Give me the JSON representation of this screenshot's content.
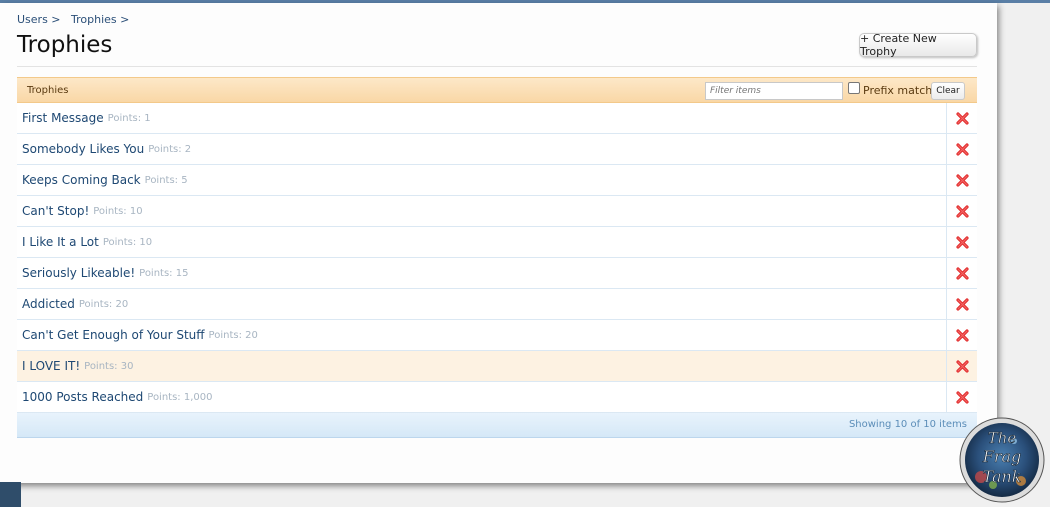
{
  "breadcrumb": [
    {
      "label": "Users >"
    },
    {
      "label": "Trophies >"
    }
  ],
  "page_title": "Trophies",
  "create_button_label": "+ Create New Trophy",
  "list_header": {
    "title": "Trophies",
    "filter_placeholder": "Filter items",
    "prefix_match_label": "Prefix match",
    "clear_label": "Clear"
  },
  "trophies": [
    {
      "name": "First Message",
      "points": "Points: 1"
    },
    {
      "name": "Somebody Likes You",
      "points": "Points: 2"
    },
    {
      "name": "Keeps Coming Back",
      "points": "Points: 5"
    },
    {
      "name": "Can't Stop!",
      "points": "Points: 10"
    },
    {
      "name": "I Like It a Lot",
      "points": "Points: 10"
    },
    {
      "name": "Seriously Likeable!",
      "points": "Points: 15"
    },
    {
      "name": "Addicted",
      "points": "Points: 20"
    },
    {
      "name": "Can't Get Enough of Your Stuff",
      "points": "Points: 20"
    },
    {
      "name": "I LOVE IT!",
      "points": "Points: 30"
    },
    {
      "name": "1000 Posts Reached",
      "points": "Points: 1,000"
    }
  ],
  "hovered_row_index": 8,
  "list_footer": {
    "count_text": "Showing 10 of 10 items"
  },
  "logo": {
    "line1": "The",
    "line2": "Frag",
    "line3": "Tank"
  },
  "colors": {
    "accent_link": "#1e4873",
    "header_bg": "#f9d7a6",
    "footer_bg": "#d5e8f7",
    "delete_icon": "#e23030"
  }
}
